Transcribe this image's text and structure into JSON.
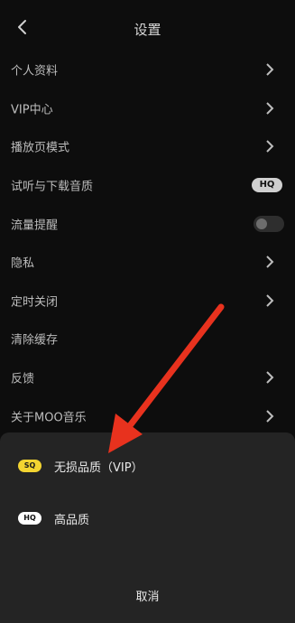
{
  "header": {
    "title": "设置"
  },
  "settings": [
    {
      "label": "个人资料",
      "accessory": "chevron"
    },
    {
      "label": "VIP中心",
      "accessory": "chevron"
    },
    {
      "label": "播放页模式",
      "accessory": "chevron"
    },
    {
      "label": "试听与下载音质",
      "accessory": "hq",
      "badge": "HQ"
    },
    {
      "label": "流量提醒",
      "accessory": "toggle",
      "toggle_on": false
    },
    {
      "label": "隐私",
      "accessory": "chevron"
    },
    {
      "label": "定时关闭",
      "accessory": "chevron"
    },
    {
      "label": "清除缓存",
      "accessory": "none"
    },
    {
      "label": "反馈",
      "accessory": "chevron"
    },
    {
      "label": "关于MOO音乐",
      "accessory": "chevron"
    }
  ],
  "sheet": {
    "options": [
      {
        "badge": "SQ",
        "label": "无损品质（VIP）"
      },
      {
        "badge": "HQ",
        "label": "高品质"
      }
    ],
    "cancel": "取消"
  },
  "colors": {
    "background": "#0d0d0d",
    "sheet": "#242424",
    "sq_badge": "#f3d431",
    "annotation_arrow": "#e8321e"
  }
}
